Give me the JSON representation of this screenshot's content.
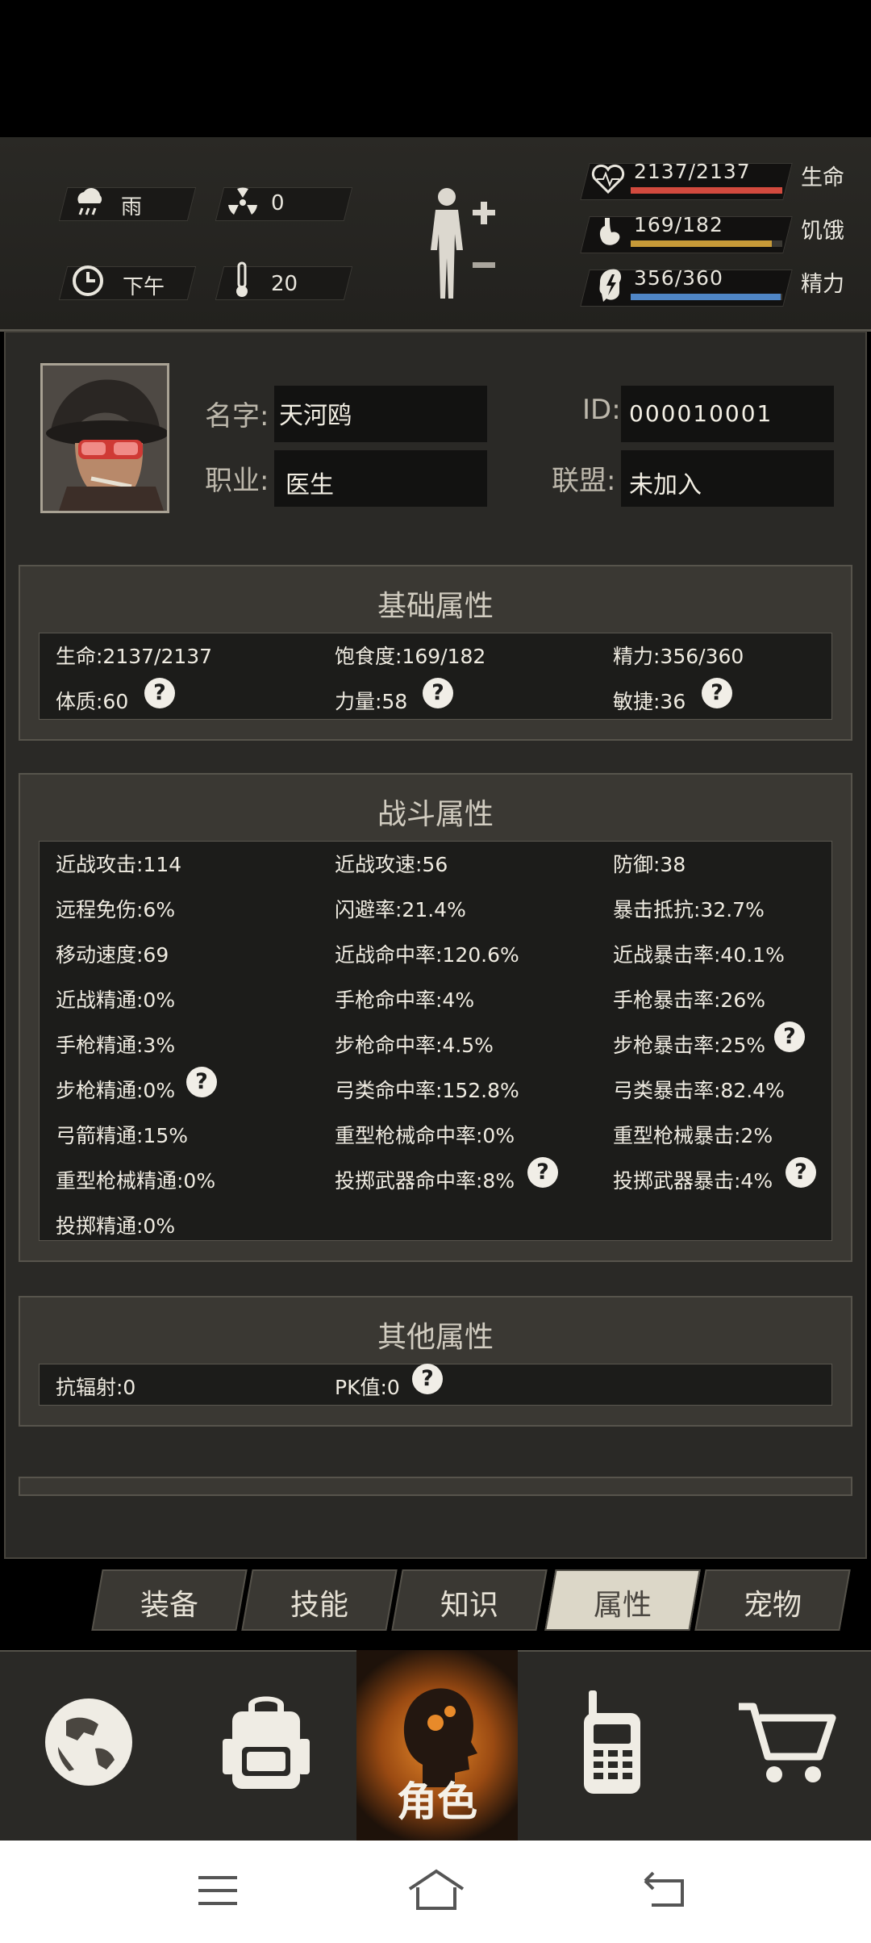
{
  "status": {
    "weather": "雨",
    "radiation": "0",
    "time_of_day": "下午",
    "temperature": "20",
    "health": {
      "text": "2137/2137",
      "label": "生命",
      "fill": 1.0,
      "color": "#d24a3e"
    },
    "hunger": {
      "text": "169/182",
      "label": "饥饿",
      "fill": 0.929,
      "color": "#c79a38"
    },
    "energy": {
      "text": "356/360",
      "label": "精力",
      "fill": 0.989,
      "color": "#4f86c6"
    }
  },
  "profile": {
    "name_label": "名字:",
    "name": "天河鸥",
    "id_label": "ID:",
    "id": "000010001",
    "job_label": "职业:",
    "job": "医生",
    "alliance_label": "联盟:",
    "alliance": "未加入"
  },
  "basic": {
    "title": "基础属性",
    "life": "生命:2137/2137",
    "satiety": "饱食度:169/182",
    "energy": "精力:356/360",
    "constitution": "体质:60",
    "strength": "力量:58",
    "agility": "敏捷:36"
  },
  "combat": {
    "title": "战斗属性",
    "stats": [
      [
        "近战攻击:114",
        "近战攻速:56",
        "防御:38"
      ],
      [
        "远程免伤:6%",
        "闪避率:21.4%",
        "暴击抵抗:32.7%"
      ],
      [
        "移动速度:69",
        "近战命中率:120.6%",
        "近战暴击率:40.1%"
      ],
      [
        "近战精通:0%",
        "手枪命中率:4%",
        "手枪暴击率:26%"
      ],
      [
        "手枪精通:3%",
        "步枪命中率:4.5%",
        "步枪暴击率:25%"
      ],
      [
        "步枪精通:0%",
        "弓类命中率:152.8%",
        "弓类暴击率:82.4%"
      ],
      [
        "弓箭精通:15%",
        "重型枪械命中率:0%",
        "重型枪械暴击:2%"
      ],
      [
        "重型枪械精通:0%",
        "投掷武器命中率:8%",
        "投掷武器暴击:4%"
      ],
      [
        "投掷精通:0%"
      ]
    ]
  },
  "other": {
    "title": "其他属性",
    "radiation_resist": "抗辐射:0",
    "pk": "PK值:0"
  },
  "tabs": [
    "装备",
    "技能",
    "知识",
    "属性",
    "宠物"
  ],
  "nav": {
    "character_label": "角色"
  },
  "help_mark": "?"
}
